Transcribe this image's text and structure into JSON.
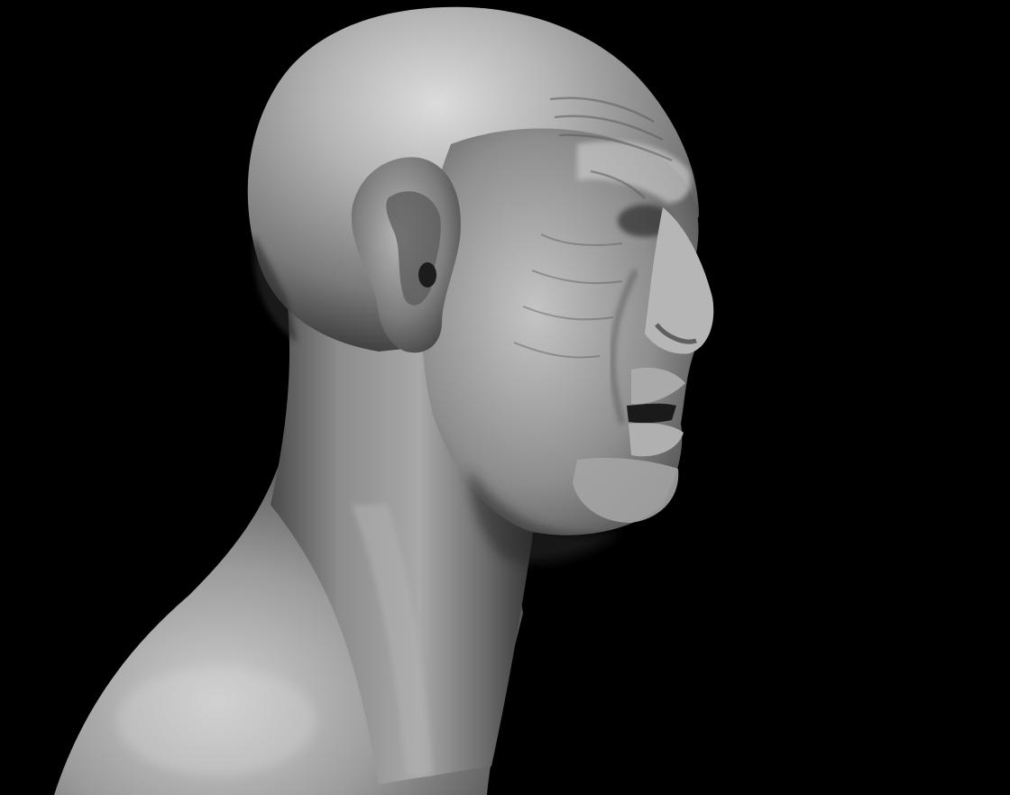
{
  "viewport": {
    "background_color": "#000000",
    "subject": "sculpt-bust"
  },
  "palette": {
    "skin_highlight": "#d8d8d8",
    "skin_mid": "#9a9a9a",
    "skin_shadow": "#3a3a3a",
    "deep_shadow": "#141414"
  }
}
